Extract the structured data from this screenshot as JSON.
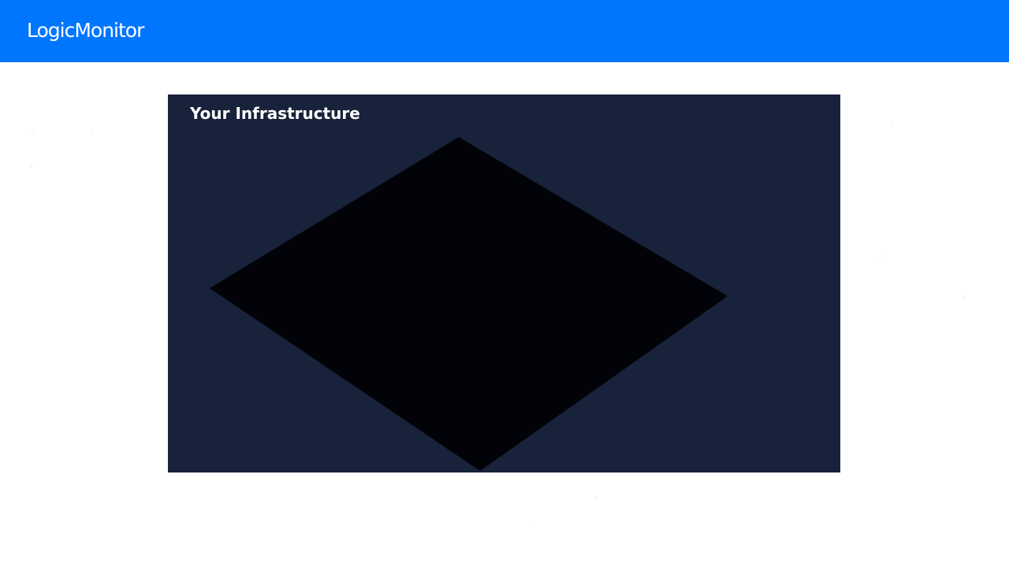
{
  "header": {
    "logo_text": "LogicMonitor",
    "background_color": "#0076ff"
  },
  "main": {
    "panel_title": "Your Infrastructure",
    "panel_background_color": "#18223a",
    "shape_color": "#020308"
  }
}
